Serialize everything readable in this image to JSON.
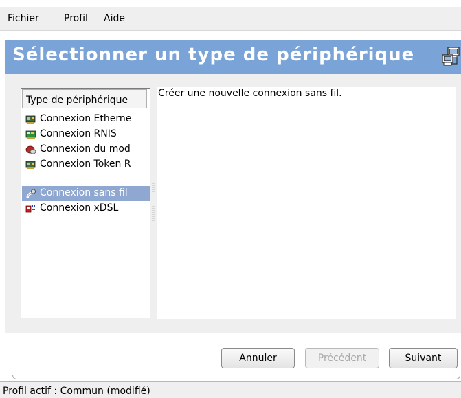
{
  "menu": [
    "Fichier",
    "Profil",
    "Aide"
  ],
  "header": {
    "title": "Sélectionner un type de périphérique",
    "background": "#7aa4d8"
  },
  "device_list": {
    "column_header": "Type de périphérique",
    "items": [
      {
        "label": "Connexion Etherne",
        "icon": "ethernet-card-icon",
        "selected": false
      },
      {
        "label": "Connexion RNIS",
        "icon": "isdn-card-icon",
        "selected": false
      },
      {
        "label": "Connexion du mod",
        "icon": "modem-icon",
        "selected": false
      },
      {
        "label": "Connexion Token R",
        "icon": "token-ring-card-icon",
        "selected": false
      },
      {
        "label": "Connexion sans fil",
        "icon": "wireless-icon",
        "selected": true
      },
      {
        "label": "Connexion xDSL",
        "icon": "xdsl-icon",
        "selected": false
      }
    ],
    "selection_color": "#8fa8d2"
  },
  "description": "Créer une nouvelle connexion sans fil.",
  "buttons": {
    "cancel": "Annuler",
    "previous": "Précédent",
    "next": "Suivant"
  },
  "status": "Profil actif : Commun (modifié)"
}
